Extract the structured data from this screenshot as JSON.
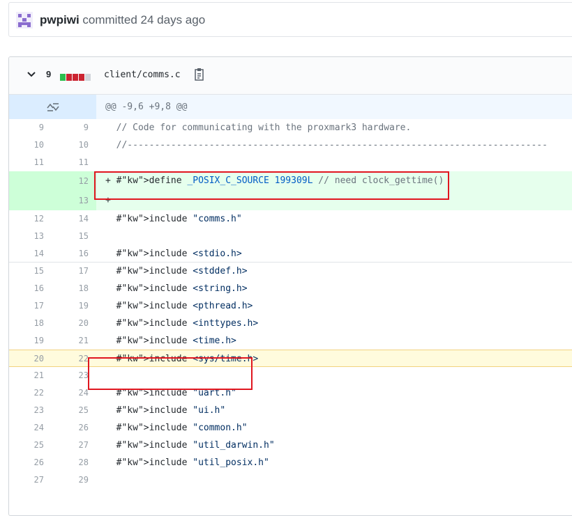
{
  "commit": {
    "author": "pwpiwi",
    "action": "committed 24 days ago"
  },
  "file": {
    "changes_count": "9",
    "path": "client/comms.c",
    "diffstat": [
      "add",
      "del",
      "del",
      "del",
      "neutral"
    ],
    "hunk_header": "@@ -9,6 +9,8 @@"
  },
  "colors": {
    "addition": "#2cbe4e",
    "deletion": "#cb2431",
    "neutral": "#d1d5da",
    "highlight_box": "#e0161f"
  },
  "lines": [
    {
      "old": "9",
      "new": "9",
      "text": "  // Code for communicating with the proxmark3 hardware."
    },
    {
      "old": "10",
      "new": "10",
      "text": "  //-----------------------------------------------------------------------------"
    },
    {
      "old": "11",
      "new": "11",
      "text": ""
    },
    {
      "old": "",
      "new": "12",
      "text": "+ #define _POSIX_C_SOURCE 199309L // need clock_gettime()"
    },
    {
      "old": "",
      "new": "13",
      "text": "+"
    },
    {
      "old": "12",
      "new": "14",
      "text": "  #include \"comms.h\""
    },
    {
      "old": "13",
      "new": "15",
      "text": ""
    },
    {
      "old": "14",
      "new": "16",
      "text": "  #include <stdio.h>"
    },
    {
      "old": "15",
      "new": "17",
      "text": "  #include <stddef.h>"
    },
    {
      "old": "16",
      "new": "18",
      "text": "  #include <string.h>"
    },
    {
      "old": "17",
      "new": "19",
      "text": "  #include <pthread.h>"
    },
    {
      "old": "18",
      "new": "20",
      "text": "  #include <inttypes.h>"
    },
    {
      "old": "19",
      "new": "21",
      "text": "  #include <time.h>"
    },
    {
      "old": "20",
      "new": "22",
      "text": "  #include <sys/time.h>"
    },
    {
      "old": "21",
      "new": "23",
      "text": ""
    },
    {
      "old": "22",
      "new": "24",
      "text": "  #include \"uart.h\""
    },
    {
      "old": "23",
      "new": "25",
      "text": "  #include \"ui.h\""
    },
    {
      "old": "24",
      "new": "26",
      "text": "  #include \"common.h\""
    },
    {
      "old": "25",
      "new": "27",
      "text": "  #include \"util_darwin.h\""
    },
    {
      "old": "26",
      "new": "28",
      "text": "  #include \"util_posix.h\""
    },
    {
      "old": "27",
      "new": "29",
      "text": ""
    }
  ]
}
